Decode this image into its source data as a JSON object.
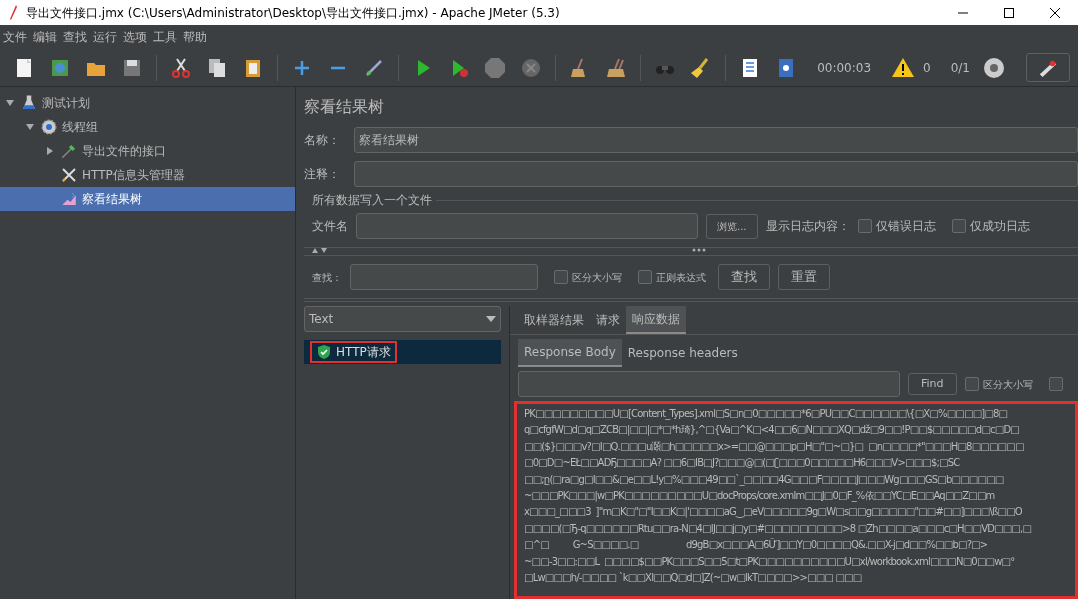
{
  "window": {
    "title": "导出文件接口.jmx (C:\\Users\\Administrator\\Desktop\\导出文件接口.jmx) - Apache JMeter (5.3)"
  },
  "menu": [
    "文件",
    "编辑",
    "查找",
    "运行",
    "选项",
    "工具",
    "帮助"
  ],
  "toolbar": {
    "timer": "00:00:03",
    "warnings": "0",
    "threads": "0/1"
  },
  "tree": [
    {
      "label": "测试计划",
      "kind": "plan",
      "expanded": true,
      "selected": false,
      "children": [
        {
          "label": "线程组",
          "kind": "group",
          "expanded": true,
          "selected": false,
          "children": [
            {
              "label": "导出文件的接口",
              "kind": "sampler",
              "expanded": false,
              "selected": false
            },
            {
              "label": "HTTP信息头管理器",
              "kind": "config",
              "selected": false
            },
            {
              "label": "察看结果树",
              "kind": "listener",
              "selected": true
            }
          ]
        }
      ]
    }
  ],
  "panel": {
    "title": "察看结果树",
    "name_label": "名称：",
    "name_value": "察看结果树",
    "comment_label": "注释：",
    "file_section": {
      "legend": "所有数据写入一个文件",
      "file_label": "文件名",
      "browse": "浏览...",
      "log_label": "显示日志内容：",
      "checks": [
        {
          "label": "仅错误日志",
          "checked": false
        },
        {
          "label": "仅成功日志",
          "checked": false
        }
      ]
    },
    "search": {
      "label": "查找：",
      "checks": [
        {
          "label": "区分大小写",
          "checked": false
        },
        {
          "label": "正则表达式",
          "checked": false
        }
      ],
      "find": "查找",
      "reset": "重置"
    },
    "renderer": "Text",
    "results": [
      {
        "label": "HTTP请求",
        "success": true,
        "selected": true,
        "highlighted": true
      }
    ],
    "tabs": [
      {
        "label": "取样器结果",
        "selected": false
      },
      {
        "label": "请求",
        "selected": false
      },
      {
        "label": "响应数据",
        "selected": true
      }
    ],
    "subtabs": [
      {
        "label": "Response Body",
        "selected": true
      },
      {
        "label": "Response headers",
        "selected": false
      }
    ],
    "find_button": "Find",
    "find_checks": [
      {
        "label": "区分大小写",
        "checked": false
      },
      {
        "checked": false
      }
    ],
    "response_lines": [
      "PK□□□□□□□□□U□[Content_Types].xml□S□n□0□□□□□*6□PU□□C□□□□□□\\{□X□%□□□□]□8□",
      "q□cfgfW□d□q□ZCB□|□□|□*□*h琦},^□{Va□^K□<4□□6□N□□□XQ□dž□9□□!P□□$□□□□□d□c□D□",
      "□□($}□□□v?□I□Q.□□□u㶊□h□□□□□x>=□□@□□□p□H□\"□~□}□  □n□□□□*\"□□□H□8□□□□□□",
      "□0□D□~EŁ□□ADҔ□□□□A? □□6□IB□J?□□□@□(□ʗ□□□0□□□□□H6□□□V>□□□$;□SC",
      "□□;ը(□ra□g□I□□&□e□□L!y□%□□□49□□`_□□□□4G□□□F□□□□J□□□Wg□□□GS□b□□□□□□",
      "~□□□PK□□□|w□PK□□□□□□□□□U□docProps/core.xmlm□□J□0□F_%依□□YC□E□□Aq□□Z□□m",
      "x□□□_□□□3  ]\"m□K□\"□\"I□□K□|'□□□□aG‿□eV□□□□□9g□W□s□□g□□□□□\"□□#□□]□□□\\ß□□O",
      "□□□□(□Ђ-q□□□□□□Rtu□□ra-N□4□IJ□□j□y□#□□□□□□□□□>8 □Zh□□□□a□□□c□H□□VD□□□,□",
      "□^□          G~S□□□□.□                    d9gB□x□□□A□6Ữ]□□Y□0□□□□Q&.□□X-j□d□□%□□b□?□>",
      "~□□-3□□:□□L  □□□□$□□PK□□□S□□5□t□PK□□□□□□□□□□U□xl/workbook.xml□□□N□0□□w□°",
      "□Lw□□□h/-□□□□ `k□□XI□□Q□d□]Z(~□w□lkT□□□□>>□□□ □□□"
    ]
  }
}
